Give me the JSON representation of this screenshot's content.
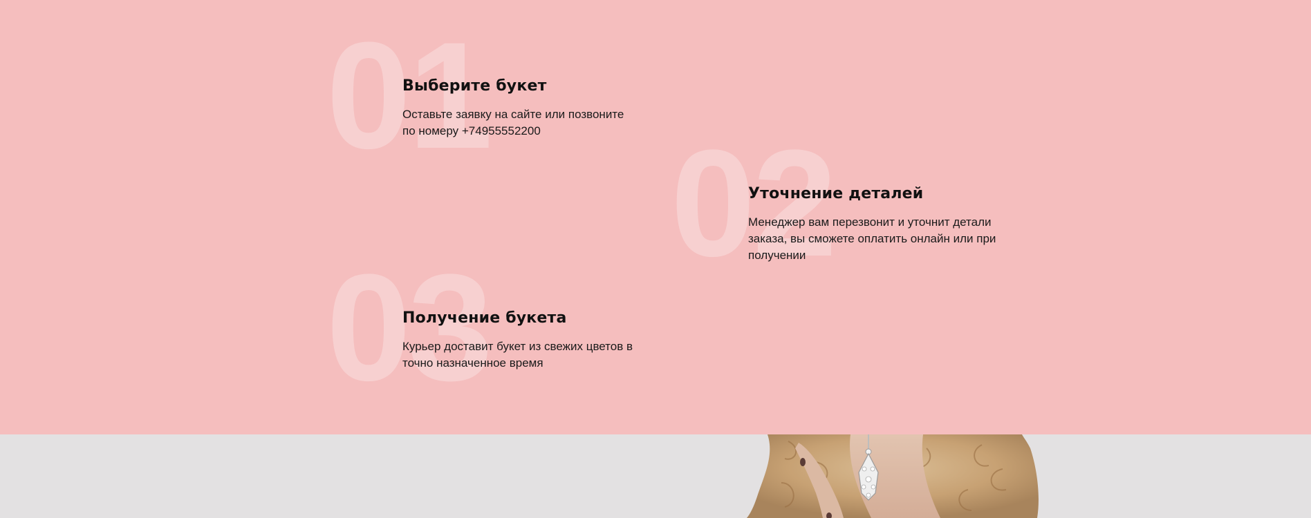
{
  "steps": [
    {
      "number": "01",
      "title": "Выберите букет",
      "text": "Оставьте заявку на сайте или позвоните по номеру +74955552200"
    },
    {
      "number": "02",
      "title": "Уточнение деталей",
      "text": "Менеджер вам перезвонит и уточнит детали заказа, вы сможете оплатить онлайн или при получении"
    },
    {
      "number": "03",
      "title": "Получение букета",
      "text": "Курьер доставит букет из свежих цветов в точно назначенное время"
    }
  ],
  "colors": {
    "section_background": "#f5bebe",
    "photo_background": "#e3e1e2",
    "title_color": "#111111",
    "text_color": "#1a1a1a"
  }
}
